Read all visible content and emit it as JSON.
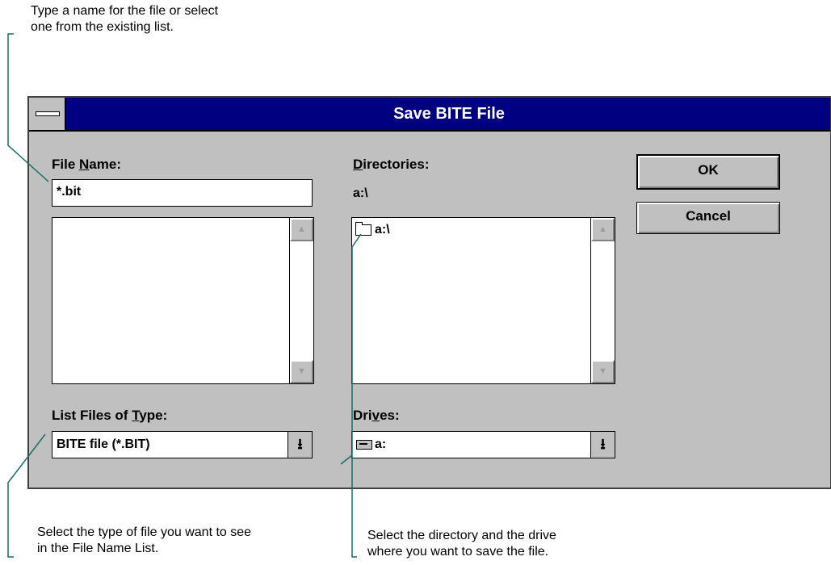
{
  "callouts": {
    "top": "Type a name for the file or select\none from the existing list.",
    "bottom_left": "Select the type of file you want to see\nin the File Name List.",
    "bottom_right": "Select the directory and the drive\nwhere you want to save the file."
  },
  "dialog": {
    "title": "Save BITE File",
    "file_name": {
      "label_pre": "File ",
      "label_underline": "N",
      "label_post": "ame:",
      "value": "*.bit"
    },
    "directories": {
      "label_underline": "D",
      "label_post": "irectories:",
      "current_path": "a:\\",
      "items": [
        {
          "name": "a:\\",
          "icon": "open-folder-icon"
        }
      ]
    },
    "file_types": {
      "label_pre": "List Files of ",
      "label_underline": "T",
      "label_post": "ype:",
      "selected": "BITE file (*.BIT)"
    },
    "drives": {
      "label_pre": "Dri",
      "label_underline": "v",
      "label_post": "es:",
      "selected": "a:",
      "icon": "floppy-drive-icon"
    },
    "buttons": {
      "ok": "OK",
      "cancel": "Cancel"
    },
    "scroll_glyphs": {
      "up": "▲",
      "down": "▼",
      "drop": "⭳"
    }
  },
  "colors": {
    "title_bar": "#000080",
    "dialog_face": "#c0c0c0",
    "leader_line": "#1a6b6b"
  }
}
